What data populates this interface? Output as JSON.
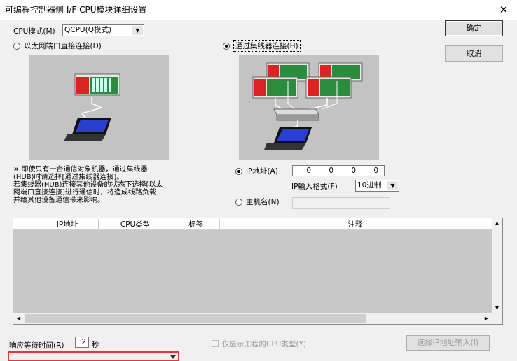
{
  "window": {
    "title": "可编程控制器侧 I/F CPU模块详细设置",
    "close_glyph": "✕"
  },
  "cpu_mode": {
    "label": "CPU模式(M)",
    "value": "QCPU(Q模式)"
  },
  "buttons": {
    "ok": "确定",
    "cancel": "取消",
    "select_ip_input": "选择IP地址输入(I)"
  },
  "connection": {
    "direct_label": "以太网端口直接连接(D)",
    "hub_label": "通过集线器连接(H)",
    "selected": "hub"
  },
  "note": "※ 即使只有一台通信对象机器，通过集线器\n(HUB)时请选择[通过集线器连接]。\n若集线器(HUB)连接其他设备的状态下选择[以太\n网端口直接连接]进行通信时，将造成线路负载\n并给其他设备通信带来影响。",
  "ip": {
    "ip_label": "IP地址(A)",
    "octets": [
      "0",
      "0",
      "0",
      "0"
    ],
    "format_label": "IP输入格式(F)",
    "format_value": "10进制",
    "host_label": "主机名(N)",
    "host_value": ""
  },
  "table": {
    "columns": [
      "IP地址",
      "CPU类型",
      "标签",
      "注释"
    ],
    "rows": []
  },
  "footer": {
    "wait_label": "响应等待时间(R)",
    "wait_value": "2",
    "wait_unit": "秒",
    "only_project_cpu": "仅显示工程的CPU类型(Y)"
  }
}
